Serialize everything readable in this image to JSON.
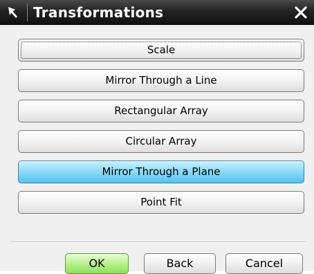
{
  "window": {
    "title": "Transformations",
    "icon": "cursor-arrow-icon",
    "close_icon": "close-icon"
  },
  "options": [
    {
      "label": "Scale",
      "state": "focused"
    },
    {
      "label": "Mirror Through a Line",
      "state": "normal"
    },
    {
      "label": "Rectangular Array",
      "state": "normal"
    },
    {
      "label": "Circular Array",
      "state": "normal"
    },
    {
      "label": "Mirror Through a Plane",
      "state": "selected"
    },
    {
      "label": "Point Fit",
      "state": "normal"
    }
  ],
  "footer": {
    "ok_label": "OK",
    "back_label": "Back",
    "cancel_label": "Cancel"
  },
  "colors": {
    "titlebar": "#1a1a1a",
    "selected_option": "#7fd4f6",
    "ok_button": "#a9ea7c"
  }
}
